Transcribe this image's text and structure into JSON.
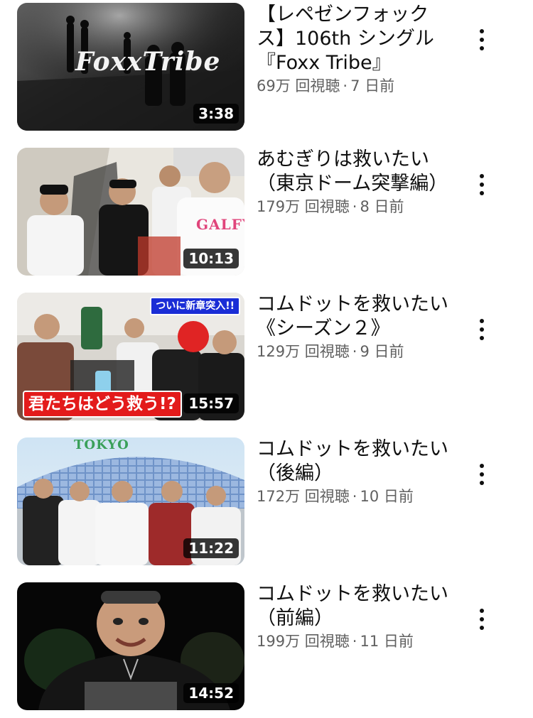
{
  "videos": [
    {
      "title": "【レペゼンフォックス】106th シングル『Foxx Tribe』",
      "views": "69万 回視聴",
      "age": "7 日前",
      "duration": "3:38",
      "thumb_text": "FoxxTribe",
      "more_icon": "more-vertical-icon"
    },
    {
      "title": "あむぎりは救いたい（東京ドーム突撃編）",
      "views": "179万 回視聴",
      "age": "8 日前",
      "duration": "10:13",
      "thumb_text": "GALFY",
      "more_icon": "more-vertical-icon"
    },
    {
      "title": "コムドットを救いたい《シーズン２》",
      "views": "129万 回視聴",
      "age": "9 日前",
      "duration": "15:57",
      "thumb_banner": "ついに新章突入!!",
      "thumb_caption": "君たちはどう救う!?",
      "more_icon": "more-vertical-icon"
    },
    {
      "title": "コムドットを救いたい（後編）",
      "views": "172万 回視聴",
      "age": "10 日前",
      "duration": "11:22",
      "thumb_text": "TOKYO",
      "more_icon": "more-vertical-icon"
    },
    {
      "title": "コムドットを救いたい（前編）",
      "views": "199万 回視聴",
      "age": "11 日前",
      "duration": "14:52",
      "more_icon": "more-vertical-icon"
    }
  ],
  "separator": "·"
}
